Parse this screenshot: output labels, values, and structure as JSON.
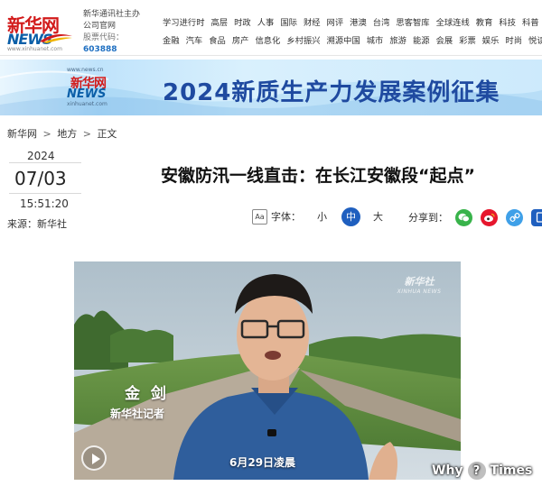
{
  "header": {
    "logo": {
      "cn": "新华网",
      "en": "NEWS",
      "domain": "www.xinhuanet.com"
    },
    "corp_line1": "新华通讯社主办",
    "corp_line2": "公司官网",
    "stock_label": "股票代码：",
    "stock_code": "603888",
    "nav_row1": [
      "学习进行时",
      "高层",
      "时政",
      "人事",
      "国际",
      "财经",
      "网评",
      "港澳",
      "台湾",
      "思客智库",
      "全球连线",
      "教育",
      "科技",
      "科普"
    ],
    "nav_row2": [
      "金融",
      "汽车",
      "食品",
      "房产",
      "信息化",
      "乡村振兴",
      "溯源中国",
      "城市",
      "旅游",
      "能源",
      "会展",
      "彩票",
      "娱乐",
      "时尚",
      "悦读"
    ]
  },
  "banner": {
    "site": "www.news.cn",
    "logo_cn": "新华网",
    "logo_en": "NEWS",
    "logo_sub": "xinhuanet.com",
    "title": "2024新质生产力发展案例征集"
  },
  "breadcrumb": [
    "新华网",
    "地方",
    "正文"
  ],
  "breadcrumb_sep": ">",
  "meta": {
    "year": "2024",
    "date": "07/03",
    "time": "15:51:20",
    "source": "来源：新华社"
  },
  "article": {
    "headline": "安徽防汛一线直击：在长江安徽段“起点”"
  },
  "font_size": {
    "label": "字体：",
    "icon_text": "Aa",
    "options": [
      "小",
      "中",
      "大"
    ],
    "selected": "中"
  },
  "share": {
    "label": "分享到："
  },
  "video": {
    "watermark_cn": "新华社",
    "watermark_en": "XINHUA NEWS",
    "caption_name": "金 剑",
    "caption_role": "新华社记者",
    "caption_time": "6月29日凌晨"
  },
  "corner_watermark": {
    "left": "Why",
    "mid": "?",
    "right": "Times"
  },
  "colors": {
    "brand_red": "#d21a1a",
    "brand_blue": "#0b5fa8",
    "banner_title": "#1f4aa0",
    "active_font": "#1f5fbf",
    "stock_code": "#1e6fc1"
  },
  "icons": [
    "aa-font-icon",
    "wechat-icon",
    "weibo-icon",
    "link-icon",
    "more-share-icon",
    "play-icon"
  ]
}
